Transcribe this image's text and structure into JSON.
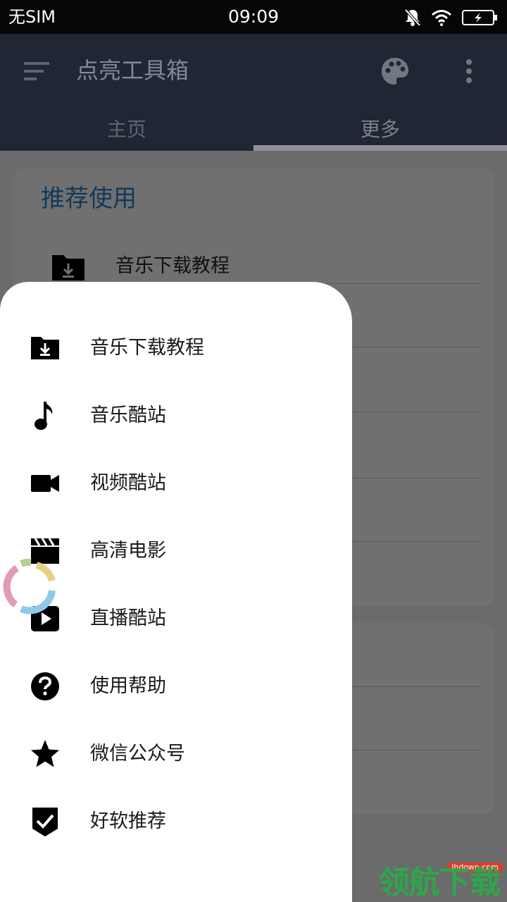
{
  "status_bar": {
    "carrier": "无SIM",
    "time": "09:09",
    "icons": [
      "bell-off-icon",
      "wifi-icon",
      "battery-charging-icon"
    ]
  },
  "app_bar": {
    "title": "点亮工具箱",
    "icons": [
      "menu-icon",
      "palette-icon",
      "more-vert-icon"
    ],
    "tabs": [
      {
        "label": "主页",
        "selected": false
      },
      {
        "label": "更多",
        "selected": true
      }
    ]
  },
  "background": {
    "card_title": "推荐使用",
    "first_item": {
      "label": "音乐下载教程",
      "icon": "folder-download-icon"
    }
  },
  "drawer": {
    "items": [
      {
        "label": "音乐下载教程",
        "icon": "folder-download-icon"
      },
      {
        "label": "音乐酷站",
        "icon": "music-note-icon"
      },
      {
        "label": "视频酷站",
        "icon": "videocam-icon"
      },
      {
        "label": "高清电影",
        "icon": "movie-icon"
      },
      {
        "label": "直播酷站",
        "icon": "live-play-icon"
      },
      {
        "label": "使用帮助",
        "icon": "help-icon"
      },
      {
        "label": "微信公众号",
        "icon": "star-icon"
      },
      {
        "label": "好软推荐",
        "icon": "verified-shield-icon"
      }
    ]
  },
  "watermark": {
    "text": "领航下载",
    "url": "lhdown.com"
  },
  "colors": {
    "app_bar": "#1e2733",
    "status_bar": "#050608",
    "scrim_content": "#6b6b6b",
    "drawer_bg": "#ffffff",
    "card_title": "#13395a",
    "watermark_green": "#2aa84a"
  }
}
